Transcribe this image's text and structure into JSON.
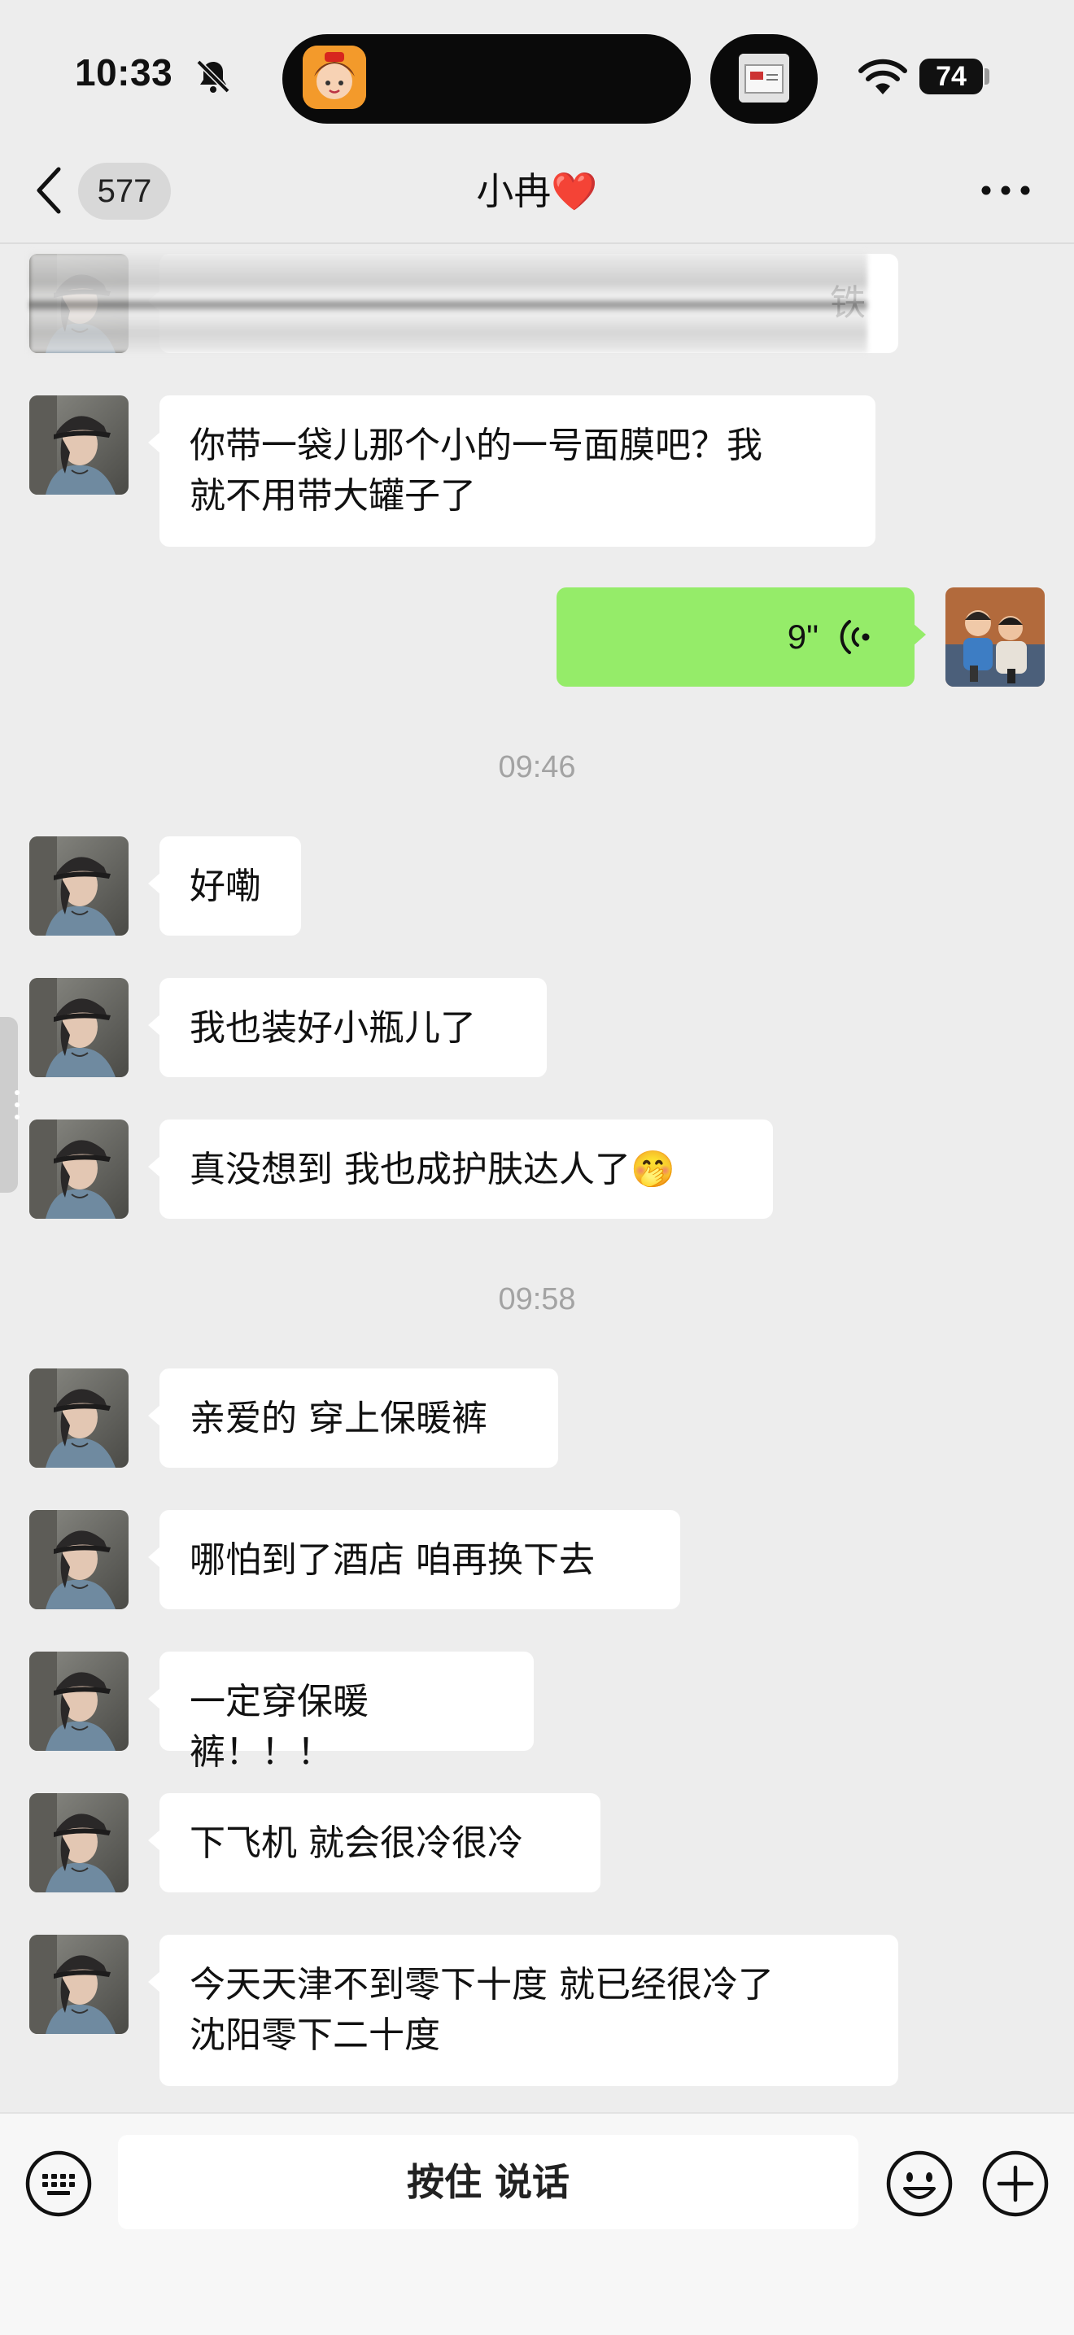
{
  "status_bar": {
    "time": "10:33",
    "battery": "74"
  },
  "nav": {
    "back_count": "577",
    "title": "小冉",
    "title_emoji": "❤️"
  },
  "messages": [
    {
      "id": 0,
      "type": "text",
      "direction": "in",
      "text": "铁",
      "partially_obscured": true
    },
    {
      "id": 1,
      "type": "text",
      "direction": "in",
      "lines": [
        "你带一袋儿那个小的一号面膜吧？我",
        "就不用带大罐子了"
      ]
    },
    {
      "id": 2,
      "type": "voice",
      "direction": "out",
      "duration": "9\""
    },
    {
      "id": 3,
      "type": "timestamp",
      "text": "09:46"
    },
    {
      "id": 4,
      "type": "text",
      "direction": "in",
      "text": "好嘞"
    },
    {
      "id": 5,
      "type": "text",
      "direction": "in",
      "text": "我也装好小瓶儿了"
    },
    {
      "id": 6,
      "type": "text",
      "direction": "in",
      "text": "真没想到 我也成护肤达人了",
      "emoji": "🤭"
    },
    {
      "id": 7,
      "type": "timestamp",
      "text": "09:58"
    },
    {
      "id": 8,
      "type": "text",
      "direction": "in",
      "text": "亲爱的 穿上保暖裤"
    },
    {
      "id": 9,
      "type": "text",
      "direction": "in",
      "text": "哪怕到了酒店 咱再换下去"
    },
    {
      "id": 10,
      "type": "text",
      "direction": "in",
      "text": "一定穿保暖裤！！！"
    },
    {
      "id": 11,
      "type": "text",
      "direction": "in",
      "text": "下飞机 就会很冷很冷"
    },
    {
      "id": 12,
      "type": "text",
      "direction": "in",
      "lines": [
        "今天天津不到零下十度 就已经很冷了",
        "沈阳零下二十度"
      ]
    }
  ],
  "input_bar": {
    "hold_to_talk_label": "按住 说话"
  },
  "icons": {
    "status": [
      "bell-slash-icon",
      "wifi-icon",
      "battery-icon"
    ],
    "nav": [
      "chevron-left-icon",
      "more-dots-icon"
    ],
    "input": [
      "keyboard-icon",
      "emoji-icon",
      "plus-icon"
    ],
    "message": [
      "voice-wave-icon"
    ]
  },
  "colors": {
    "background": "#ededed",
    "bubble_in": "#ffffff",
    "bubble_out": "#95ec69",
    "timestamp": "#a3a3a3",
    "heart": "#e0202a"
  }
}
